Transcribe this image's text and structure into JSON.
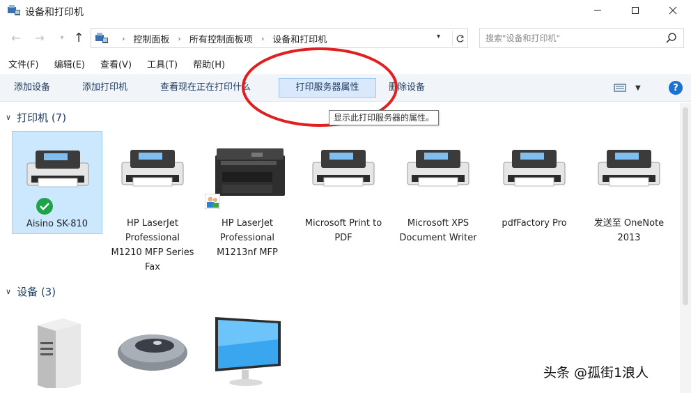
{
  "window": {
    "title": "设备和打印机",
    "controls": {
      "minimize_icon": "minimize-icon",
      "maximize_icon": "maximize-icon",
      "close_icon": "close-icon"
    }
  },
  "address": {
    "breadcrumbs": [
      "控制面板",
      "所有控制面板项",
      "设备和打印机"
    ],
    "search_placeholder": "搜索\"设备和打印机\""
  },
  "menu": {
    "items": [
      "文件(F)",
      "编辑(E)",
      "查看(V)",
      "工具(T)",
      "帮助(H)"
    ]
  },
  "commands": {
    "add_device": "添加设备",
    "add_printer": "添加打印机",
    "see_printing": "查看现在正在打印什么",
    "print_server_props": "打印服务器属性",
    "remove_device": "删除设备",
    "help": "?"
  },
  "tooltip": "显示此打印服务器的属性。",
  "groups": {
    "printers": {
      "header": "打印机 (7)",
      "items": [
        {
          "label": "Aisino SK-810",
          "default": true
        },
        {
          "label": "HP LaserJet Professional M1210 MFP Series Fax"
        },
        {
          "label": "HP LaserJet Professional M1213nf MFP",
          "shared": true
        },
        {
          "label": "Microsoft Print to PDF"
        },
        {
          "label": "Microsoft XPS Document Writer"
        },
        {
          "label": "pdfFactory Pro"
        },
        {
          "label": "发送至 OneNote 2013"
        }
      ]
    },
    "devices": {
      "header": "设备 (3)",
      "items": [
        {
          "icon": "computer-tower-icon"
        },
        {
          "icon": "mouse-icon"
        },
        {
          "icon": "monitor-icon"
        }
      ]
    }
  },
  "colors": {
    "accent": "#1a73d0",
    "selection": "#cce8ff",
    "annotation": "#e02020",
    "cmdbar": "#f1f4f9"
  },
  "watermark": "头条 @孤街1浪人"
}
